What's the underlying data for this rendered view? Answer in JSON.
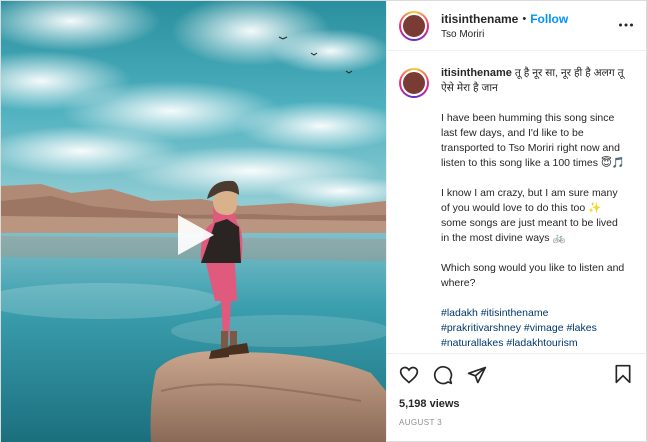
{
  "post": {
    "username": "itisinthename",
    "location": "Tso Moriri",
    "follow_label": "Follow",
    "separator": "•"
  },
  "caption": {
    "headline": "तू है नूर सा, नूर ही है अलग तू ऐसे मेरा है जान",
    "paragraphs": [
      "I have been humming this song since last few days, and I'd like to be transported to Tso Moriri right now and listen to this song like a 100 times 😇🎵",
      "I know I am crazy, but I am sure many of you would love to do this too ✨ some songs are just meant to be lived in the most divine ways 🚲",
      "Which song would you like to listen and where?"
    ],
    "hashtags": "#ladakh #itisinthename #prakritivarshney #vimage #lakes #naturallakes #ladakhtourism"
  },
  "stats": {
    "likes": "5,198 views",
    "date": "AUGUST 3"
  },
  "icons": {
    "play": "play-icon",
    "more": "more-options-icon",
    "like": "heart-icon",
    "comment": "comment-icon",
    "share": "paper-plane-icon",
    "save": "bookmark-icon"
  },
  "colors": {
    "follow": "#0095f6",
    "text": "#262626",
    "muted": "#8e8e8e",
    "hashtag": "#00376b",
    "border": "#dbdbdb"
  }
}
